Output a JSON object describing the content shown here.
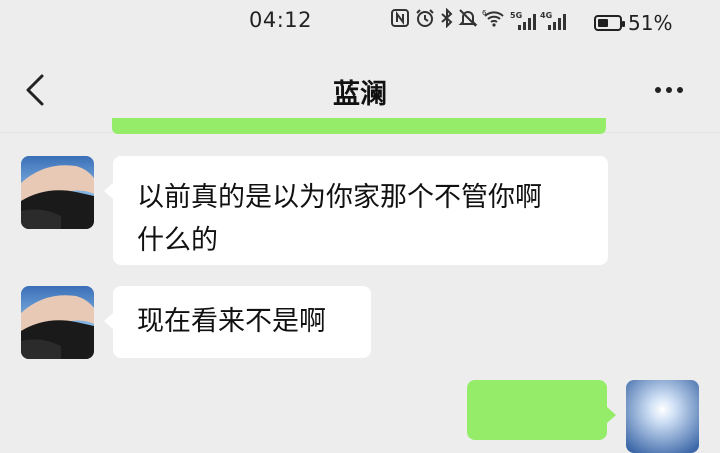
{
  "status_bar": {
    "time": "04:12",
    "icons": [
      "nfc-icon",
      "alarm-icon",
      "bluetooth-icon",
      "mute-icon",
      "wifi-6-icon",
      "signal-5g-icon",
      "signal-4g-icon",
      "battery-icon"
    ],
    "net1": "5G",
    "net2": "4G",
    "battery_percent": "51%",
    "battery_level": 0.51
  },
  "nav": {
    "title": "蓝澜"
  },
  "messages": [
    {
      "side": "left",
      "text_line1": "以前真的是以为你家那个不管你啊",
      "text_line2": "什么的"
    },
    {
      "side": "left",
      "text_line1": "现在看来不是啊"
    },
    {
      "side": "right",
      "text_line1": ""
    }
  ],
  "colors": {
    "background": "#ededed",
    "self_bubble": "#95ec69",
    "other_bubble": "#ffffff"
  }
}
